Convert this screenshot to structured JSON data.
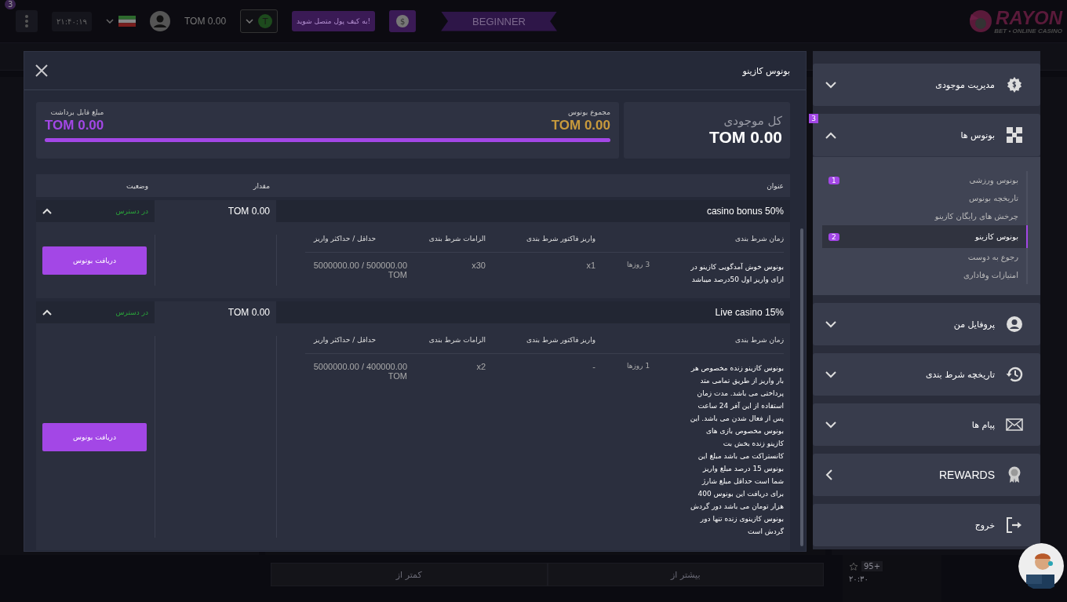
{
  "topbar": {
    "menu_badge": "3",
    "time": "۲۱:۴۰:۱۹",
    "balance": "TOM 0.00",
    "wallet_token": "T",
    "connect_wallet": "به کیف پول متصل شوید!",
    "currency_symbol": "$",
    "level": "BEGINNER",
    "logo_title": "RAYON",
    "logo_subtitle": "BET • ONLINE CASINO"
  },
  "background": {
    "odds_buttons": [
      "بیشتر از",
      "کمتر از"
    ],
    "match_badge": "95+",
    "match_time": "۲۰:۳۰"
  },
  "modal": {
    "title": "بونوس کازینو",
    "summary": {
      "total_label": "کل موجودی",
      "total_value": "TOM 0.00",
      "bonus_label": "مجموع بونوس",
      "bonus_value": "TOM 0.00",
      "withdraw_label": "مبلغ قابل برداشت",
      "withdraw_value": "TOM 0.00",
      "level": 1
    },
    "columns": [
      "عنوان",
      "مقدار",
      "وضعیت"
    ],
    "bonuses": [
      {
        "title": "casino bonus 50%",
        "amount": "TOM 0.00",
        "status": "در دسترس",
        "expanded": true,
        "detail_columns": [
          "زمان شرط بندی",
          "واریز فاکتور شرط بندی",
          "الزامات شرط بندی",
          "حداقل / حداکثر واریز"
        ],
        "description": "بونوس خوش آمدگویی کازینو در ازای واریز اول 50درصد میباشد",
        "wager_time": "3 روزها",
        "deposit_factor": "x1",
        "wager_requirement": "x30",
        "min_max": "5000000.00 / 500000.00 TOM",
        "button": "دریافت بونوس"
      },
      {
        "title": "Live casino 15%",
        "amount": "TOM 0.00",
        "status": "در دسترس",
        "expanded": true,
        "detail_columns": [
          "زمان شرط بندی",
          "واریز فاکتور شرط بندی",
          "الزامات شرط بندی",
          "حداقل / حداکثر واریز"
        ],
        "description": "بونوس کازینو زنده مخصوص هر بار واریز از طریق تمامی متد پرداختی می باشد. مدت زمان استفاده از این آفر 24 ساعت پس از فعال شدن می باشد. این بونوس مخصوص بازی های کازینو زنده بخش بت کانستراکت می باشد مبلغ این بونوس 15 درصد مبلغ واریز شما است حداقل مبلغ شارژ برای دریافت این بونوس 400 هزار تومان می باشد دور گردش بونوس کازینوی زنده تنها دور گردش است",
        "wager_time": "1 روزها",
        "deposit_factor": "-",
        "wager_requirement": "x2",
        "min_max": "5000000.00 / 400000.00 TOM",
        "button": "دریافت بونوس"
      }
    ]
  },
  "sidebar": {
    "items": [
      {
        "kind": "accordion",
        "label": "مدیریت موجودی",
        "expanded": false
      },
      {
        "kind": "accordion",
        "label": "بونوس ها",
        "expanded": true,
        "badge": "3",
        "children": [
          {
            "label": "بونوس ورزشی",
            "badge": "1",
            "selected": false
          },
          {
            "label": "تاریخچه بونوس",
            "selected": false
          },
          {
            "label": "چرخش های رایگان کازینو",
            "selected": false
          },
          {
            "label": "بونوس کازینو",
            "badge": "2",
            "selected": true
          },
          {
            "label": "رجوع به دوست",
            "selected": false
          },
          {
            "label": "امتیازات وفاداری",
            "selected": false
          }
        ]
      },
      {
        "kind": "accordion",
        "label": "پروفایل من",
        "expanded": false
      },
      {
        "kind": "accordion",
        "label": "تاریخچه شرط بندی",
        "expanded": false
      },
      {
        "kind": "accordion",
        "label": "پیام ها",
        "expanded": false
      },
      {
        "kind": "link",
        "label": "REWARDS"
      },
      {
        "kind": "action",
        "label": "خروج"
      }
    ]
  }
}
